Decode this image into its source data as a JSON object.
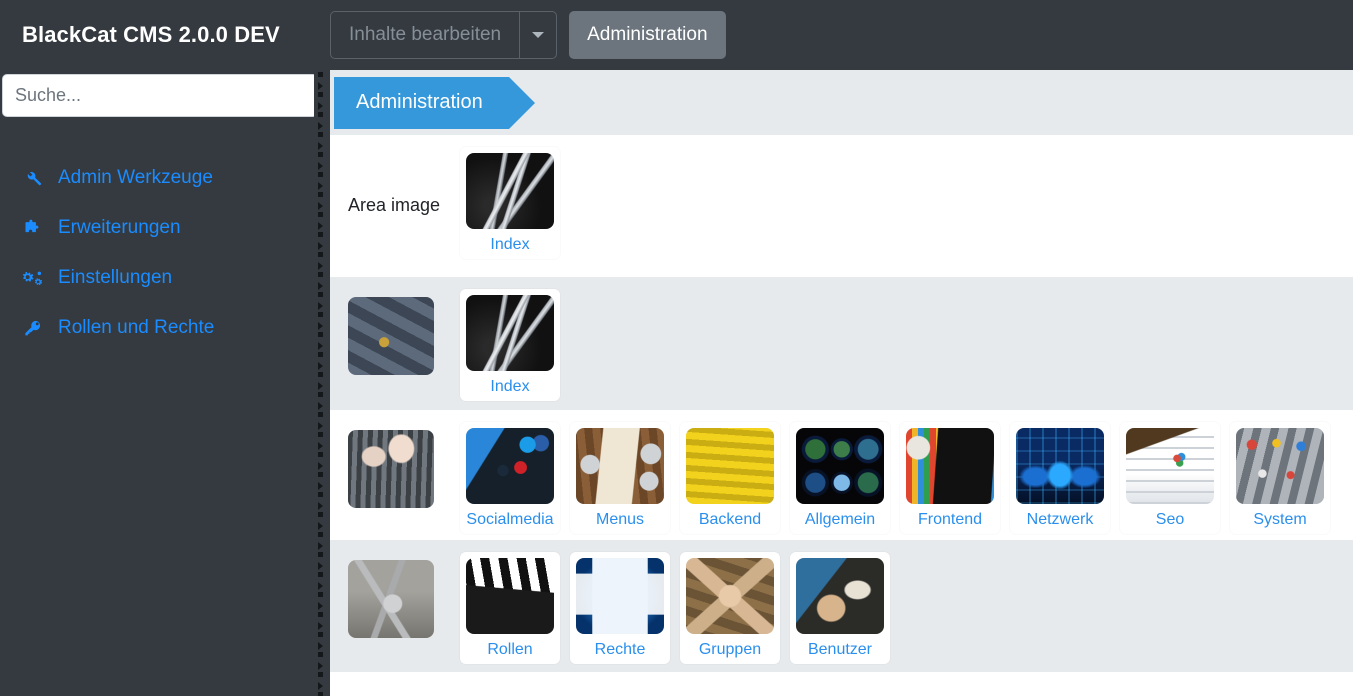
{
  "topbar": {
    "brand": "BlackCat CMS 2.0.0 DEV",
    "dropdown_label": "Inhalte bearbeiten",
    "dropdown_caret_icon": "chevron-down-icon",
    "admin_button": "Administration"
  },
  "sidebar": {
    "search_placeholder": "Suche...",
    "search_value": "",
    "items": [
      {
        "label": "Admin Werkzeuge",
        "icon": "wrench-icon"
      },
      {
        "label": "Erweiterungen",
        "icon": "puzzle-piece-icon"
      },
      {
        "label": "Einstellungen",
        "icon": "cogs-icon"
      },
      {
        "label": "Rollen und Rechte",
        "icon": "key-icon"
      }
    ]
  },
  "main": {
    "tab": "Administration",
    "area_image_label": "Area image",
    "rows": [
      {
        "background": "white",
        "lead_thumb": null,
        "cards": [
          {
            "label": "Index",
            "icon": "wrenches-photo"
          }
        ]
      },
      {
        "background": "grey",
        "lead_thumb": "stone-keys-photo",
        "cards": [
          {
            "label": "Index",
            "icon": "wrenches-photo"
          }
        ]
      },
      {
        "background": "white",
        "lead_thumb": "mixer-hands-photo",
        "cards": [
          {
            "label": "Socialmedia",
            "icon": "social-apps-photo"
          },
          {
            "label": "Menus",
            "icon": "table-setting-photo"
          },
          {
            "label": "Backend",
            "icon": "yellow-cables-photo"
          },
          {
            "label": "Allgemein",
            "icon": "globes-photo"
          },
          {
            "label": "Frontend",
            "icon": "tv-screen-photo"
          },
          {
            "label": "Netzwerk",
            "icon": "network-screens-photo"
          },
          {
            "label": "Seo",
            "icon": "tablet-chart-photo"
          },
          {
            "label": "System",
            "icon": "mixer-board-photo"
          }
        ]
      },
      {
        "background": "grey",
        "lead_thumb": "keyring-photo",
        "cards": [
          {
            "label": "Rollen",
            "icon": "clapperboard-photo"
          },
          {
            "label": "Rechte",
            "icon": "login-dialog-photo"
          },
          {
            "label": "Gruppen",
            "icon": "hands-together-photo"
          },
          {
            "label": "Benutzer",
            "icon": "id-card-photo"
          }
        ]
      }
    ]
  },
  "colors": {
    "topbar_bg": "#343a40",
    "sidebar_bg": "#343a40",
    "accent_blue": "#3498db",
    "link_blue": "#1a8cff",
    "row_grey": "#e7eaed",
    "row_white": "#ffffff",
    "nav_button_bg": "#6c757d"
  }
}
